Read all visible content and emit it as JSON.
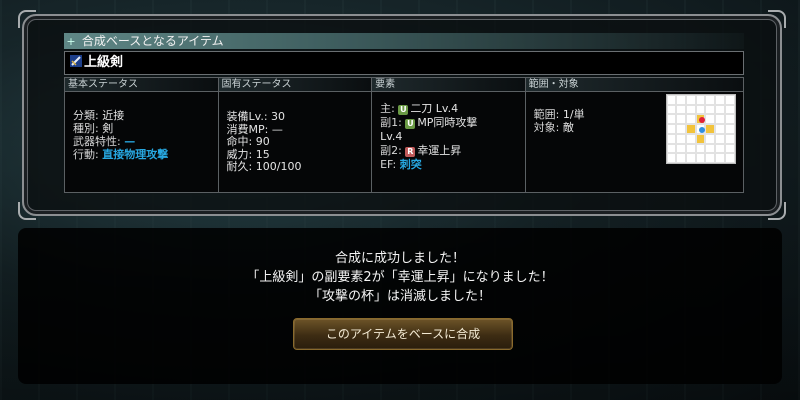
{
  "base_section": {
    "header": "合成ベースとなるアイテム"
  },
  "item": {
    "name": "上級剣",
    "icon": "sword-icon"
  },
  "stats": {
    "basic": {
      "header": "基本ステータス",
      "classification_label": "分類:",
      "classification_value": "近接",
      "type_label": "種別:",
      "type_value": "剣",
      "weapon_trait_label": "武器特性:",
      "weapon_trait_value": "—",
      "action_label": "行動:",
      "action_value": "直接物理攻撃"
    },
    "unique": {
      "header": "固有ステータス",
      "lines": [
        "装備Lv.: 30",
        "消費MP: —",
        "命中: 90",
        "威力: 15",
        "耐久: 100/100"
      ]
    },
    "elements": {
      "header": "要素",
      "main_label": "主:",
      "main_badge": "U",
      "main_value": "二刀 Lv.4",
      "sub1_label": "副1:",
      "sub1_badge": "U",
      "sub1_value": "MP同時攻撃",
      "sub1_level": "Lv.4",
      "sub2_label": "副2:",
      "sub2_badge": "R",
      "sub2_value": "幸運上昇",
      "ef_label": "EF:",
      "ef_value": "刺突"
    },
    "range": {
      "header": "範囲・対象",
      "range_label": "範囲:",
      "range_value": "1/単",
      "target_label": "対象:",
      "target_value": "敵"
    }
  },
  "result": {
    "line1": "合成に成功しました！",
    "line2": "「上級剣」の副要素2が「幸運上昇」になりました！",
    "line3": "「攻撃の杯」は消滅しました！",
    "button_label": "このアイテムをベースに合成"
  },
  "colors": {
    "accent_blue": "#27a7e0",
    "range_yellow": "#f2c33b",
    "range_red": "#e0203a",
    "range_blue": "#2f8ee0",
    "badge_u": "#6a9a45",
    "badge_r": "#c05a5a"
  }
}
